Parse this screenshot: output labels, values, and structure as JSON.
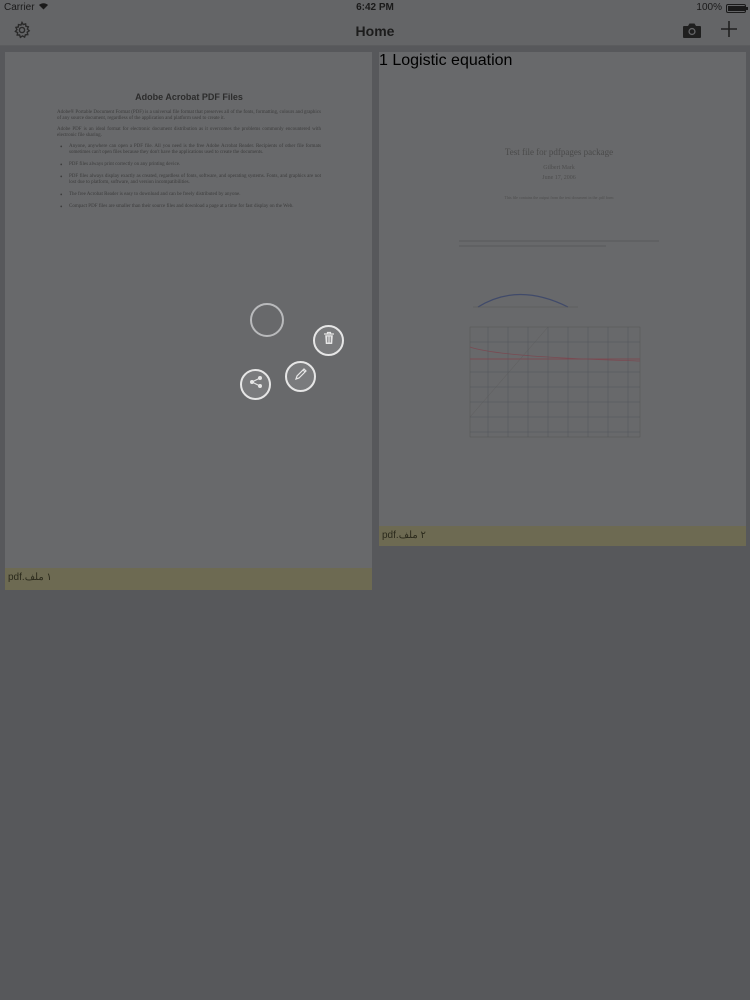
{
  "status_bar": {
    "carrier": "Carrier",
    "time": "6:42 PM",
    "battery_percent": "100%",
    "battery_level": 1.0
  },
  "nav_bar": {
    "title": "Home",
    "left_icon": "gear-icon",
    "right_icons": [
      "camera-icon",
      "plus-icon"
    ]
  },
  "documents": [
    {
      "footer_label": "pdf.١ ملف",
      "page": {
        "title": "Adobe Acrobat PDF Files",
        "paragraphs": [
          "Adobe® Portable Document Format (PDF) is a universal file format that preserves all of the fonts, formatting, colours and graphics of any source document, regardless of the application and platform used to create it.",
          "Adobe PDF is an ideal format for electronic document distribution as it overcomes the problems commonly encountered with electronic file sharing."
        ],
        "bullets": [
          "Anyone, anywhere can open a PDF file. All you need is the free Adobe Acrobat Reader. Recipients of other file formats sometimes can't open files because they don't have the applications used to create the documents.",
          "PDF files always print correctly on any printing device.",
          "PDF files always display exactly as created, regardless of fonts, software, and operating systems. Fonts, and graphics are not lost due to platform, software, and version incompatibilities.",
          "The free Acrobat Reader is easy to download and can be freely distributed by anyone.",
          "Compact PDF files are smaller than their source files and download a page at a time for fast display on the Web."
        ]
      }
    },
    {
      "footer_label": "pdf.٢ ملف",
      "page": {
        "title": "Test file for pdfpages package",
        "author": "Gilbert Mark",
        "date": "June 17, 2006",
        "note": "This file contains the output from the test document in the .pdf form",
        "section": "1   Logistic equation"
      }
    }
  ],
  "context_menu": {
    "actions": [
      "trash-icon",
      "pencil-icon",
      "share-icon"
    ]
  }
}
